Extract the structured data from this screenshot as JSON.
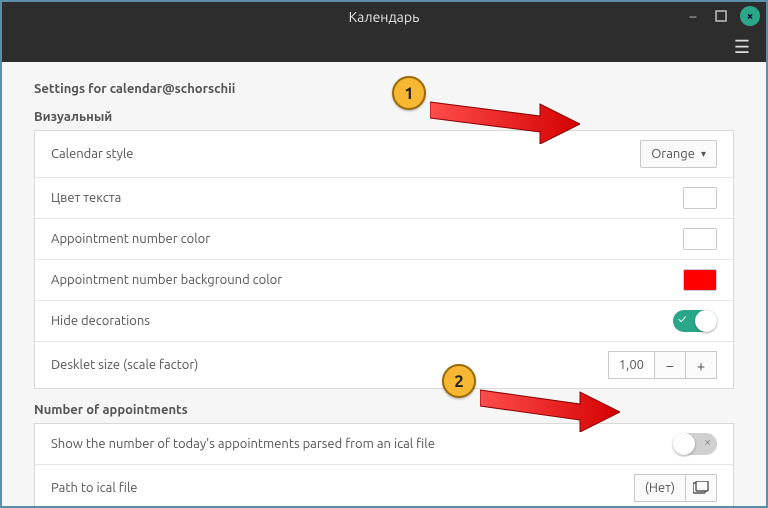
{
  "window": {
    "title": "Календарь"
  },
  "header": {
    "settings_for": "Settings for calendar@schorschii"
  },
  "sections": {
    "visual": {
      "title": "Визуальный",
      "rows": {
        "style_label": "Calendar style",
        "style_value": "Orange",
        "text_color_label": "Цвет текста",
        "text_color_value": "#ffffff",
        "appt_num_color_label": "Appointment number color",
        "appt_num_color_value": "#ffffff",
        "appt_num_bg_label": "Appointment number background color",
        "appt_num_bg_value": "#ff0000",
        "hide_deco_label": "Hide decorations",
        "hide_deco_on": true,
        "scale_label": "Desklet size (scale factor)",
        "scale_value": "1,00"
      }
    },
    "appointments": {
      "title": "Number of appointments",
      "rows": {
        "show_num_label": "Show the number of today's appointments parsed from an ical file",
        "show_num_on": false,
        "path_label": "Path to ical file",
        "path_value": "(Нет)"
      }
    }
  },
  "callouts": {
    "one": "1",
    "two": "2"
  },
  "glyphs": {
    "minus": "−",
    "plus": "+",
    "check": "✓",
    "x": "×",
    "caret": "▾"
  }
}
